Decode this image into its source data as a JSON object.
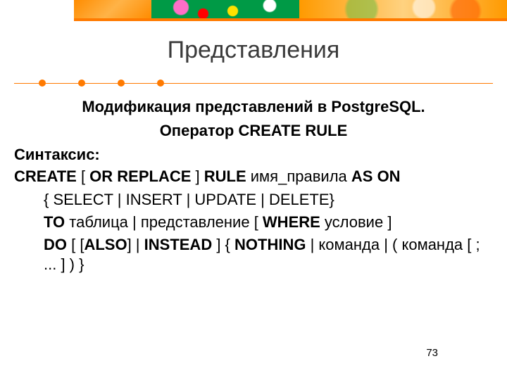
{
  "title": "Представления",
  "subtitle_line1": "Модификация представлений в PostgreSQL.",
  "subtitle_line2": "Оператор CREATE RULE",
  "syntax_label": "Синтаксис:",
  "syntax": {
    "l1a": "CREATE",
    "l1b": " [ ",
    "l1c": "OR REPLACE",
    "l1d": " ] ",
    "l1e": "RULE",
    "l1f": " имя_правила ",
    "l1g": "AS ON",
    "l1h": " { SELECT | INSERT | UPDATE | DELETE}",
    "l2a": "TO",
    "l2b": " таблица | представление [ ",
    "l2c": "WHERE",
    "l2d": " условие ]",
    "l3a": "DO",
    "l3b": " [ [",
    "l3c": "ALSO",
    "l3d": "] | ",
    "l3e": "INSTEAD",
    "l3f": " ] { ",
    "l3g": "NOTHING",
    "l3h": " | команда | ( команда [ ; ... ] ) }"
  },
  "page_number": "73"
}
